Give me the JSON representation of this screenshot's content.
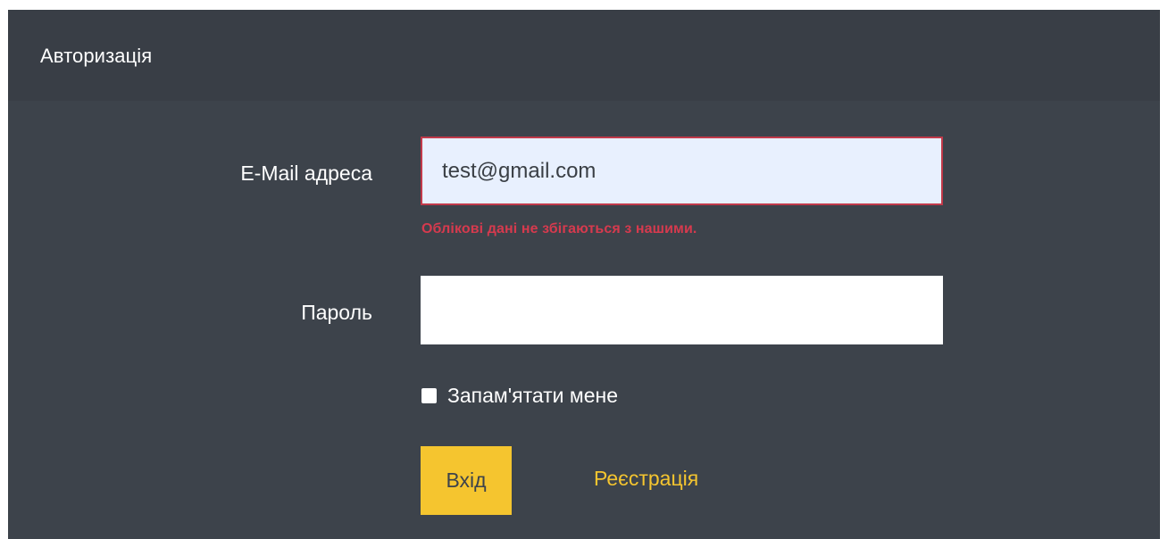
{
  "card": {
    "title": "Авторизація"
  },
  "form": {
    "email_label": "E-Mail адреса",
    "email_value": "test@gmail.com",
    "email_error": "Облікові дані не збігаються з нашими.",
    "password_label": "Пароль",
    "password_value": "",
    "remember_label": "Запам'ятати мене",
    "remember_checked": false,
    "login_button": "Вхід",
    "register_link": "Реєстрація"
  },
  "colors": {
    "card_background": "#3d434b",
    "header_background": "#393e46",
    "accent": "#f5c52f",
    "error": "#d63a4e",
    "autofill_background": "#e8f0fe"
  }
}
